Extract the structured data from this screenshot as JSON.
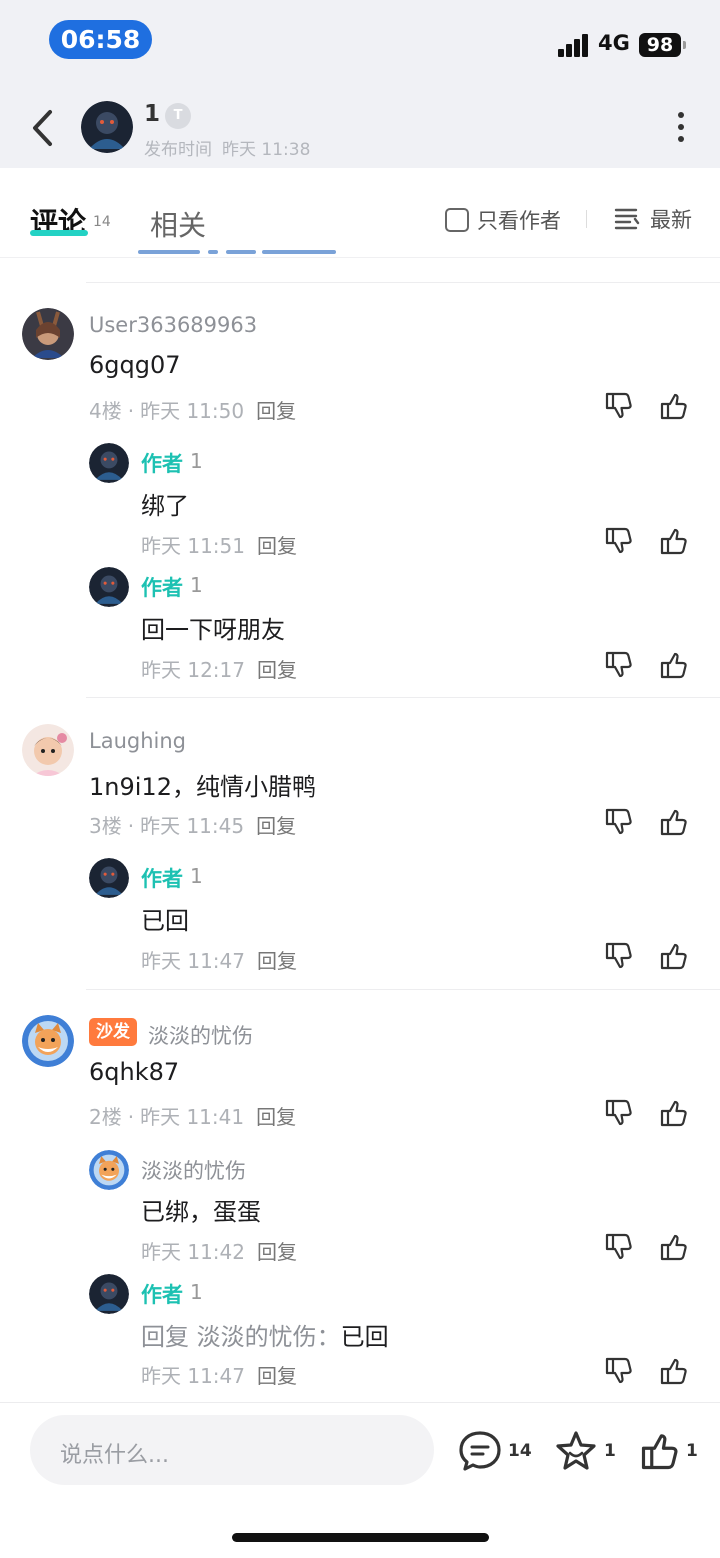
{
  "status_bar": {
    "time": "06:58",
    "network": "4G",
    "battery": "98"
  },
  "header": {
    "author_name": "1",
    "badge": "T",
    "publish_label": "发布时间",
    "publish_time": "昨天 11:38"
  },
  "tabs": {
    "comment_label": "评论",
    "comment_count": "14",
    "related_label": "相关",
    "only_author_label": "只看作者",
    "sort_label": "最新"
  },
  "comments": [
    {
      "user": "User363689963",
      "text": "6gqg07",
      "floor": "4楼",
      "time": "昨天 11:50",
      "reply_label": "回复",
      "replies": [
        {
          "author_tag": "作者",
          "user": "1",
          "text": "绑了",
          "time": "昨天 11:51",
          "reply_label": "回复"
        },
        {
          "author_tag": "作者",
          "user": "1",
          "text": "回一下呀朋友",
          "time": "昨天 12:17",
          "reply_label": "回复"
        }
      ]
    },
    {
      "user": "Laughing",
      "text": "1n9i12，纯情小腊鸭",
      "floor": "3楼",
      "time": "昨天 11:45",
      "reply_label": "回复",
      "replies": [
        {
          "author_tag": "作者",
          "user": "1",
          "text": "已回",
          "time": "昨天 11:47",
          "reply_label": "回复"
        }
      ]
    },
    {
      "badge": "沙发",
      "user": "淡淡的忧伤",
      "text": "6qhk87",
      "floor": "2楼",
      "time": "昨天 11:41",
      "reply_label": "回复",
      "replies": [
        {
          "user": "淡淡的忧伤",
          "text": "已绑，蛋蛋",
          "time": "昨天 11:42",
          "reply_label": "回复"
        },
        {
          "author_tag": "作者",
          "user": "1",
          "reply_prefix": "回复 淡淡的忧伤：",
          "text": "已回",
          "time": "昨天 11:47",
          "reply_label": "回复"
        }
      ]
    }
  ],
  "bottom_bar": {
    "input_placeholder": "说点什么...",
    "comment_count": "14",
    "favorite_count": "1",
    "like_count": "1"
  },
  "colors": {
    "accent": "#23d2c4",
    "author_tag": "#1dc1b2",
    "time_pill": "#1f6fe0",
    "sofa_badge": "#ff7a3d"
  },
  "icons": [
    "back-icon",
    "more-icon",
    "checkbox-icon",
    "sort-icon",
    "dislike-icon",
    "like-icon",
    "comment-icon",
    "favorite-icon"
  ]
}
